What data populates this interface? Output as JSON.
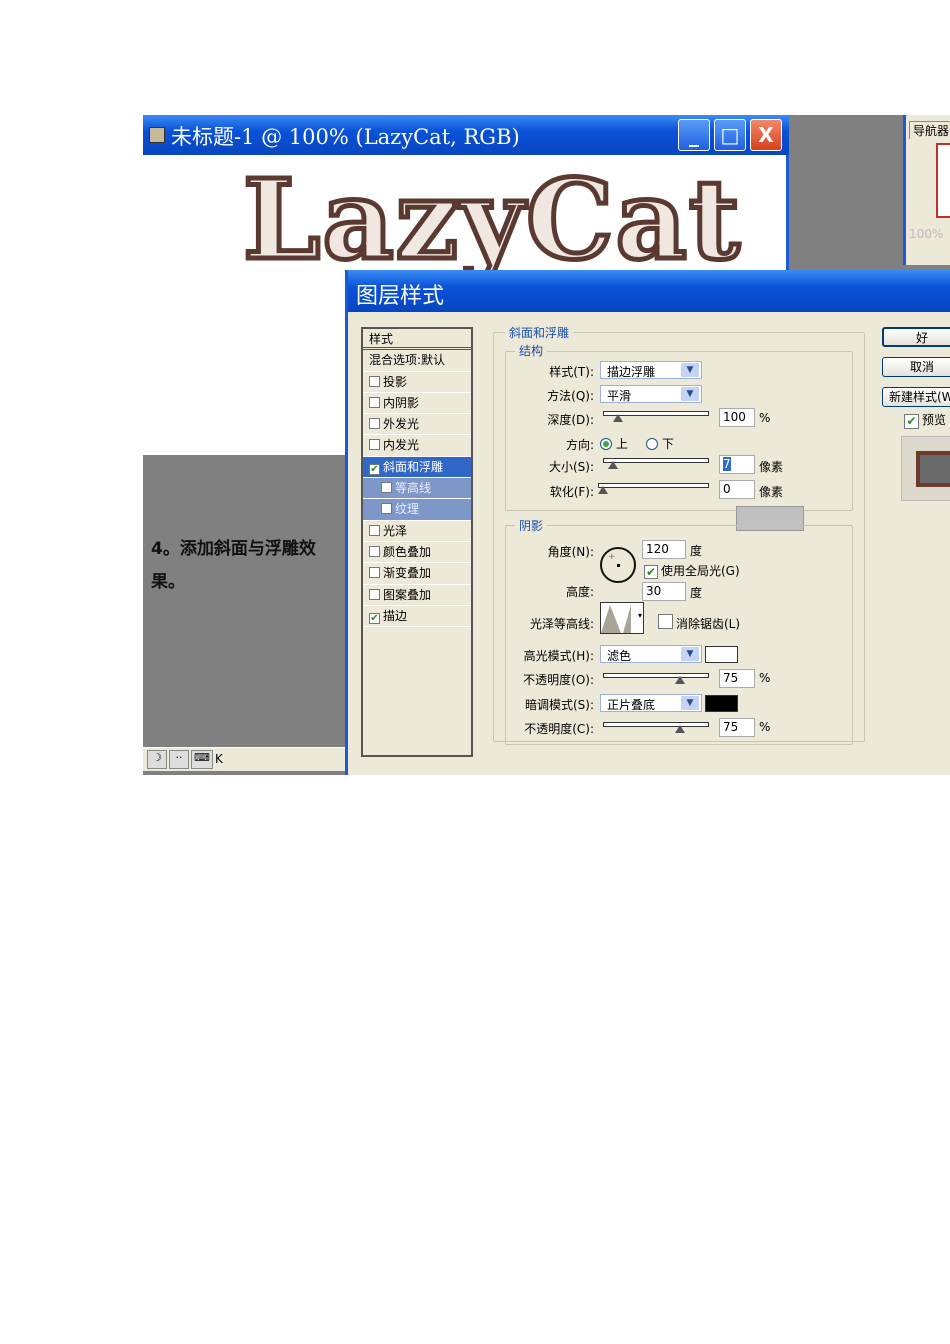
{
  "document_window": {
    "title": "未标题-1 @ 100% (LazyCat, RGB)",
    "canvas_text": "LazyCat",
    "minimize": "_",
    "maximize": "□",
    "close": "X",
    "status_text": "K"
  },
  "navigator_panel": {
    "tab": "导航器",
    "zoom": "100%"
  },
  "instruction_text": "4。添加斜面与浮雕效果。",
  "dialog": {
    "title": "图层样式",
    "styles_list": {
      "header": "样式",
      "blend_options": "混合选项:默认",
      "items": [
        {
          "label": "投影",
          "checked": false
        },
        {
          "label": "内阴影",
          "checked": false
        },
        {
          "label": "外发光",
          "checked": false
        },
        {
          "label": "内发光",
          "checked": false
        },
        {
          "label": "斜面和浮雕",
          "checked": true,
          "selected": true
        },
        {
          "label": "等高线",
          "checked": false,
          "sub": true
        },
        {
          "label": "纹理",
          "checked": false,
          "sub": true
        },
        {
          "label": "光泽",
          "checked": false
        },
        {
          "label": "颜色叠加",
          "checked": false
        },
        {
          "label": "渐变叠加",
          "checked": false
        },
        {
          "label": "图案叠加",
          "checked": false
        },
        {
          "label": "描边",
          "checked": true
        }
      ]
    },
    "bevel": {
      "group_title": "斜面和浮雕",
      "structure": {
        "title": "结构",
        "style_label": "样式(T):",
        "style_value": "描边浮雕",
        "technique_label": "方法(Q):",
        "technique_value": "平滑",
        "depth_label": "深度(D):",
        "depth_value": "100",
        "depth_unit": "%",
        "depth_slider_pct": 10,
        "direction_label": "方向:",
        "direction_up": "上",
        "direction_down": "下",
        "size_label": "大小(S):",
        "size_value": "7",
        "size_unit": "像素",
        "size_slider_pct": 5,
        "soften_label": "软化(F):",
        "soften_value": "0",
        "soften_unit": "像素",
        "soften_slider_pct": 0
      },
      "shading": {
        "title": "阴影",
        "angle_label": "角度(N):",
        "angle_value": "120",
        "angle_unit": "度",
        "global_light_label": "使用全局光(G)",
        "global_light_checked": true,
        "altitude_label": "高度:",
        "altitude_value": "30",
        "altitude_unit": "度",
        "gloss_contour_label": "光泽等高线:",
        "anti_alias_label": "消除锯齿(L)",
        "anti_alias_checked": false,
        "highlight_mode_label": "高光模式(H):",
        "highlight_mode_value": "滤色",
        "highlight_color": "#ffffff",
        "highlight_opacity_label": "不透明度(O):",
        "highlight_opacity_value": "75",
        "highlight_opacity_unit": "%",
        "shadow_mode_label": "暗调模式(S):",
        "shadow_mode_value": "正片叠底",
        "shadow_color": "#000000",
        "shadow_opacity_label": "不透明度(C):",
        "shadow_opacity_value": "75",
        "shadow_opacity_unit": "%"
      }
    },
    "buttons": {
      "ok": "好",
      "cancel": "取消",
      "new_style": "新建样式(W)...",
      "preview": "预览",
      "preview_checked": true
    }
  }
}
